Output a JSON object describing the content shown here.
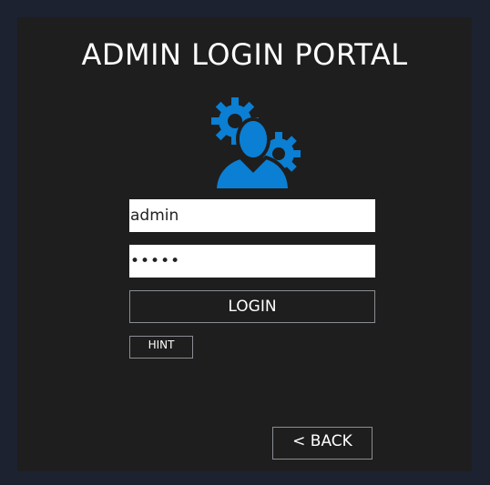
{
  "page": {
    "title": "ADMIN LOGIN PORTAL"
  },
  "icon": {
    "name": "admin-gear-user-icon",
    "color": "#0a7fd3"
  },
  "form": {
    "username_value": "admin",
    "password_value": "•••••",
    "login_label": "LOGIN",
    "hint_label": "HINT"
  },
  "nav": {
    "back_label": "< BACK"
  },
  "colors": {
    "outer_background": "#1d2231",
    "panel_background": "#1e1e1e",
    "accent": "#0a7fd3",
    "button_border": "#8a8d93"
  }
}
